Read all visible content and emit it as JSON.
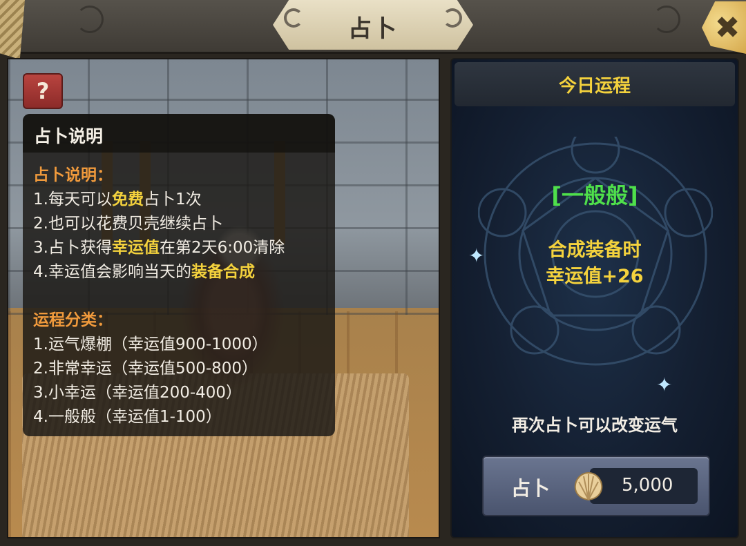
{
  "header": {
    "title": "占卜",
    "close_symbol": "✖"
  },
  "left_panel": {
    "help_button": "?",
    "info_title": "占卜说明",
    "rules_heading": "占卜说明：",
    "rule1": {
      "pre": "1.每天可以",
      "hl": "免费",
      "post": "占卜1次"
    },
    "rule2": "2.也可以花费贝壳继续占卜",
    "rule3": {
      "pre": "3.占卜获得",
      "hl": "幸运值",
      "post": "在第2天6:00清除"
    },
    "rule4": {
      "pre": "4.幸运值会影响当天的",
      "hl": "装备合成",
      "post": ""
    },
    "types_heading": "运程分类：",
    "types": [
      "1.运气爆棚（幸运值900-1000）",
      "2.非常幸运（幸运值500-800）",
      "3.小幸运（幸运值200-400）",
      "4.一般般（幸运值1-100）"
    ]
  },
  "right_panel": {
    "title": "今日运程",
    "result": "[一般般]",
    "effect_line1": "合成装备时",
    "effect_line2": "幸运值+26",
    "hint": "再次占卜可以改变运气",
    "button_label": "占卜",
    "cost_icon": "shell-icon",
    "cost": "5,000"
  },
  "colors": {
    "accent_yellow": "#f4d23d",
    "accent_orange": "#f09a3c",
    "result_green": "#4fe04b"
  }
}
